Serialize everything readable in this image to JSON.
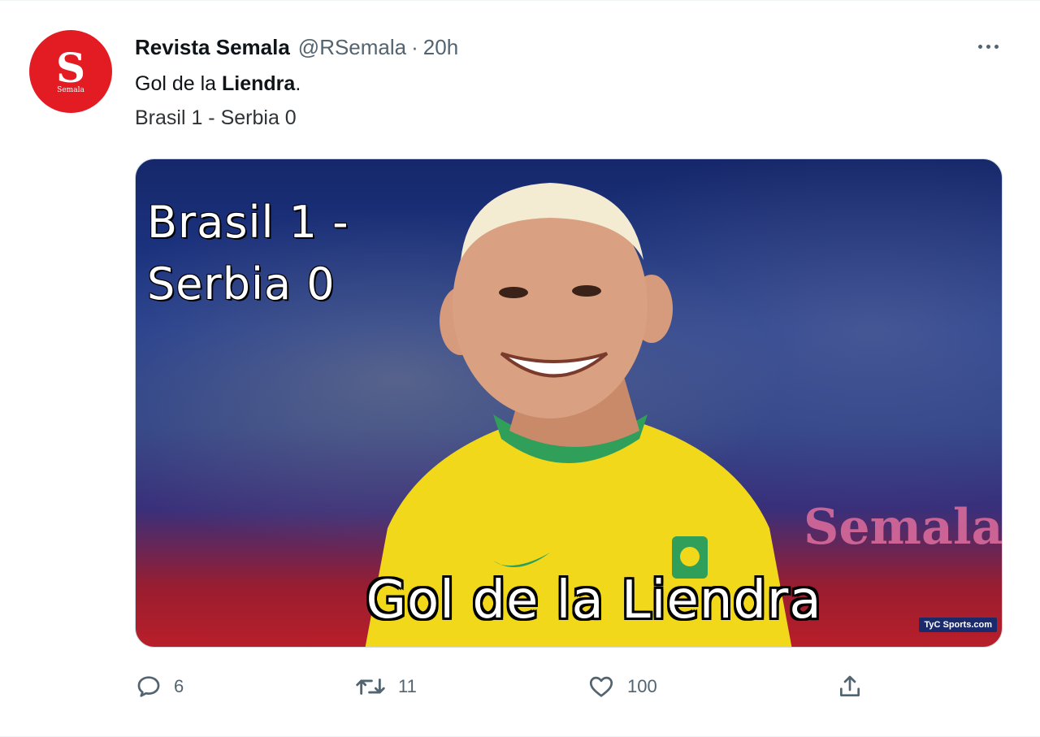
{
  "tweet": {
    "avatar": {
      "letter": "S",
      "sublabel": "Semala",
      "color": "#e31b23"
    },
    "display_name": "Revista Semala",
    "handle": "@RSemala",
    "separator": "·",
    "time": "20h",
    "text": {
      "line1_prefix": "Gol de la ",
      "line1_bold": "Liendra",
      "line1_suffix": ".",
      "line2": "Brasil 1 - Serbia 0"
    },
    "media": {
      "score_line1": "Brasil 1 -",
      "score_line2": "Serbia 0",
      "caption": "Gol de la Liendra",
      "watermark": "Semala",
      "source_badge": "TyC Sports.com"
    },
    "actions": {
      "reply_count": "6",
      "retweet_count": "11",
      "like_count": "100"
    },
    "icons": {
      "more": "more-icon",
      "reply": "reply-icon",
      "retweet": "retweet-icon",
      "like": "heart-icon",
      "share": "share-icon"
    }
  }
}
